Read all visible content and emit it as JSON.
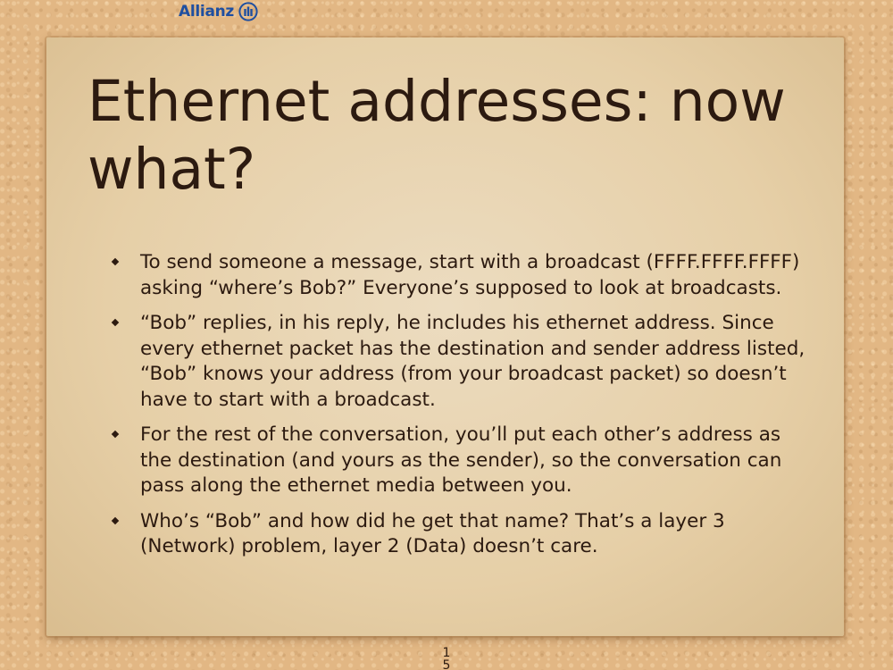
{
  "logo": {
    "text": "Allianz",
    "icon": "allianz-logo-icon",
    "brand_color": "#1f4fa0"
  },
  "slide": {
    "title": "Ethernet addresses: now what?",
    "bullets": [
      "To send someone a message, start with a broadcast (FFFF.FFFF.FFFF) asking “where’s Bob?” Everyone’s supposed to look at broadcasts.",
      "“Bob” replies, in his reply, he includes his ethernet address. Since every ethernet packet has the destination and sender address listed, “Bob” knows your address (from your broadcast packet) so doesn’t have to start with a broadcast.",
      "For the rest of the conversation, you’ll put each other’s address as the destination (and yours as the sender), so the conversation can pass along the ethernet media between you.",
      "Who’s “Bob” and how did he get that name? That’s a layer 3 (Network) problem, layer 2 (Data) doesn’t care."
    ],
    "page_number": "15"
  },
  "colors": {
    "background": "#e2b784",
    "card": "#e8d2ad",
    "text": "#2c1a10"
  }
}
